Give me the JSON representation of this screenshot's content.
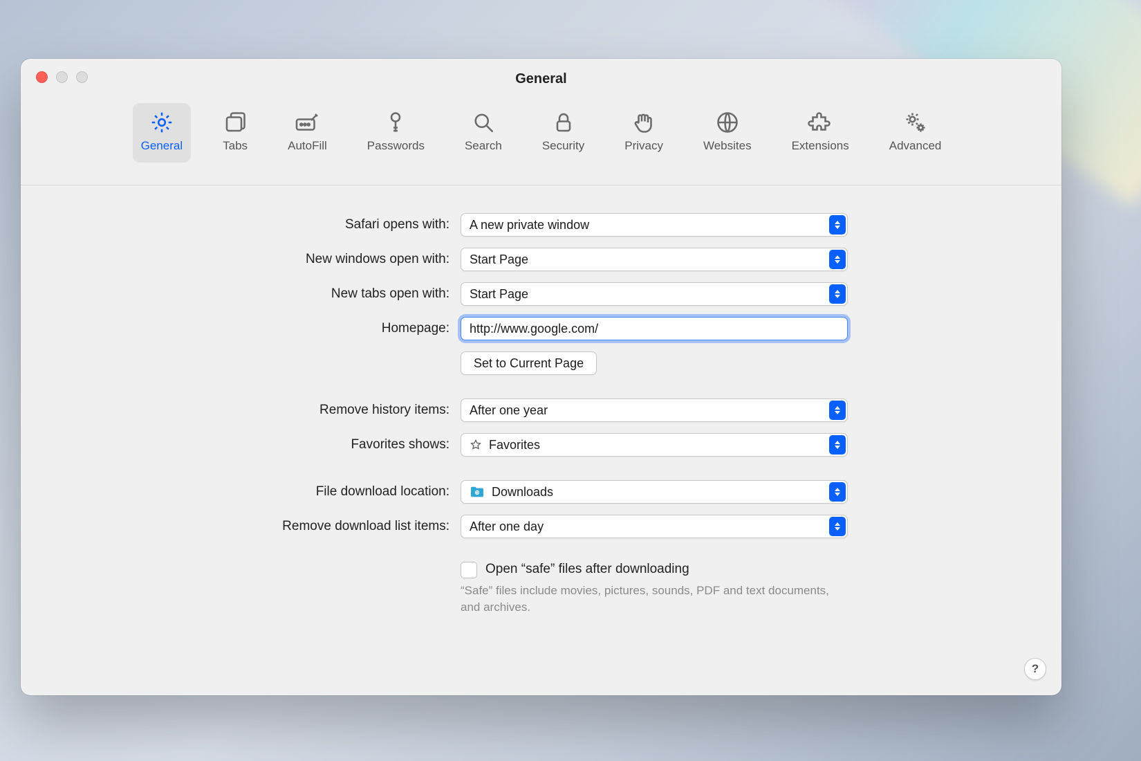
{
  "window": {
    "title": "General"
  },
  "toolbar": {
    "items": [
      {
        "label": "General",
        "icon": "gear-icon",
        "active": true
      },
      {
        "label": "Tabs",
        "icon": "tabs-icon",
        "active": false
      },
      {
        "label": "AutoFill",
        "icon": "autofill-icon",
        "active": false
      },
      {
        "label": "Passwords",
        "icon": "key-icon",
        "active": false
      },
      {
        "label": "Search",
        "icon": "search-icon",
        "active": false
      },
      {
        "label": "Security",
        "icon": "lock-icon",
        "active": false
      },
      {
        "label": "Privacy",
        "icon": "hand-icon",
        "active": false
      },
      {
        "label": "Websites",
        "icon": "globe-icon",
        "active": false
      },
      {
        "label": "Extensions",
        "icon": "puzzle-icon",
        "active": false
      },
      {
        "label": "Advanced",
        "icon": "gears-icon",
        "active": false
      }
    ]
  },
  "form": {
    "safari_opens_with": {
      "label": "Safari opens with:",
      "value": "A new private window"
    },
    "new_windows_open_with": {
      "label": "New windows open with:",
      "value": "Start Page"
    },
    "new_tabs_open_with": {
      "label": "New tabs open with:",
      "value": "Start Page"
    },
    "homepage": {
      "label": "Homepage:",
      "value": "http://www.google.com/"
    },
    "set_current_page_btn": "Set to Current Page",
    "remove_history_items": {
      "label": "Remove history items:",
      "value": "After one year"
    },
    "favorites_shows": {
      "label": "Favorites shows:",
      "value": "Favorites"
    },
    "file_download_location": {
      "label": "File download location:",
      "value": "Downloads"
    },
    "remove_download_list": {
      "label": "Remove download list items:",
      "value": "After one day"
    },
    "open_safe_files": {
      "checked": false,
      "label": "Open “safe” files after downloading",
      "hint": "“Safe” files include movies, pictures, sounds, PDF and text documents, and archives."
    }
  },
  "help_button": "?"
}
